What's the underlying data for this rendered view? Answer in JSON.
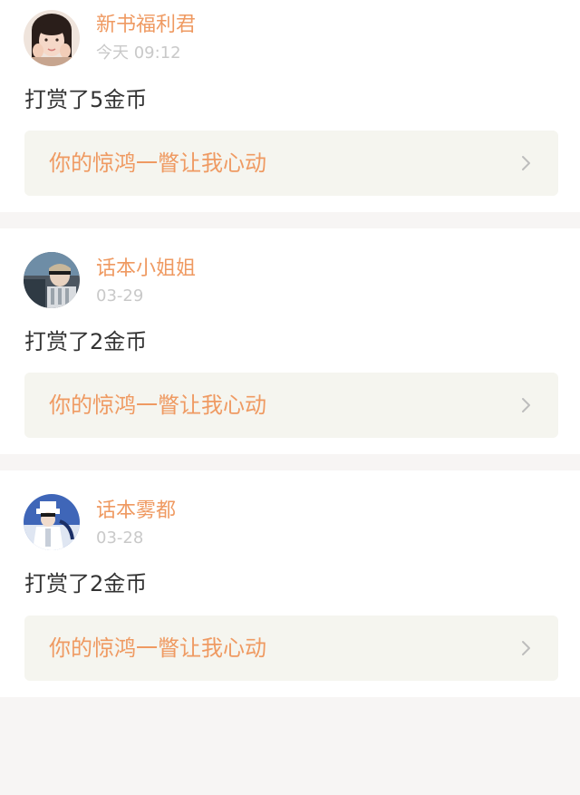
{
  "feed": {
    "items": [
      {
        "username": "新书福利君",
        "timestamp": "今天 09:12",
        "action": "打赏了5金币",
        "book_title": "你的惊鸿一瞥让我心动"
      },
      {
        "username": "话本小姐姐",
        "timestamp": "03-29",
        "action": "打赏了2金币",
        "book_title": "你的惊鸿一瞥让我心动"
      },
      {
        "username": "话本雾都",
        "timestamp": "03-28",
        "action": "打赏了2金币",
        "book_title": "你的惊鸿一瞥让我心动"
      }
    ]
  },
  "icons": {
    "chevron": "chevron-right-icon",
    "avatar": "avatar"
  },
  "colors": {
    "accent": "#ef9a62",
    "muted": "#c9c9c9",
    "text": "#333333",
    "link_bg": "#f5f5ef",
    "page_bg": "#f7f5f4"
  }
}
